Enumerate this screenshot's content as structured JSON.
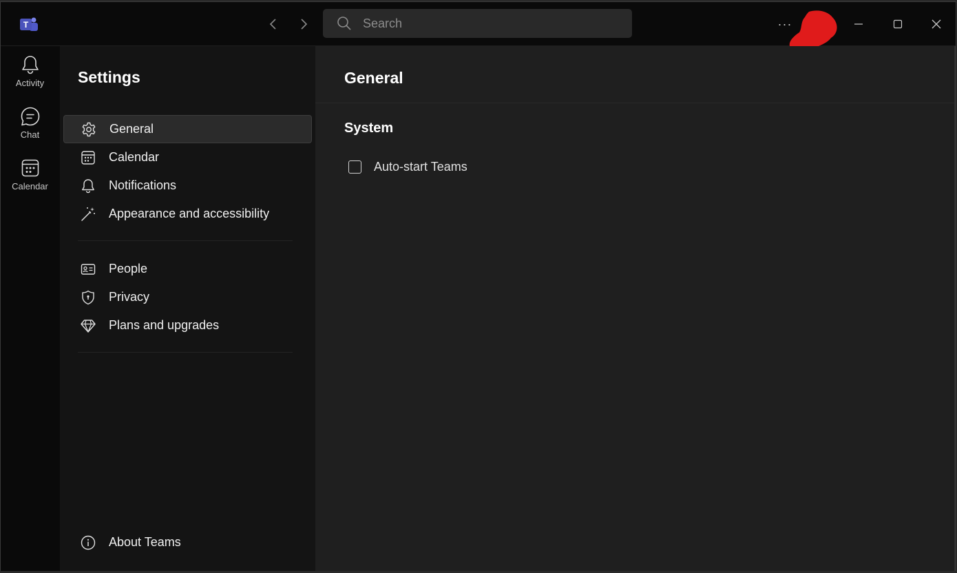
{
  "app": {
    "logo_letter": "T",
    "accent": "#7b83eb"
  },
  "search": {
    "placeholder": "Search"
  },
  "titlebar": {
    "more_label": "···"
  },
  "rail": {
    "items": [
      {
        "label": "Activity",
        "icon": "bell-icon"
      },
      {
        "label": "Chat",
        "icon": "chat-icon"
      },
      {
        "label": "Calendar",
        "icon": "calendar-icon"
      }
    ]
  },
  "settings": {
    "title": "Settings",
    "items": [
      {
        "label": "General",
        "icon": "gear-icon",
        "active": true
      },
      {
        "label": "Calendar",
        "icon": "calendar-icon"
      },
      {
        "label": "Notifications",
        "icon": "bell-icon"
      },
      {
        "label": "Appearance and accessibility",
        "icon": "magic-wand-icon"
      },
      {
        "label": "People",
        "icon": "contact-card-icon"
      },
      {
        "label": "Privacy",
        "icon": "shield-icon"
      },
      {
        "label": "Plans and upgrades",
        "icon": "diamond-icon"
      }
    ],
    "about": {
      "label": "About Teams",
      "icon": "info-icon"
    }
  },
  "content": {
    "title": "General",
    "section": "System",
    "options": [
      {
        "label": "Auto-start Teams",
        "checked": false
      }
    ]
  },
  "colors": {
    "window_bg": "#0a0a0a",
    "panel_bg": "#141414",
    "content_bg": "#1f1f1f",
    "redaction": "#e01b1b"
  }
}
